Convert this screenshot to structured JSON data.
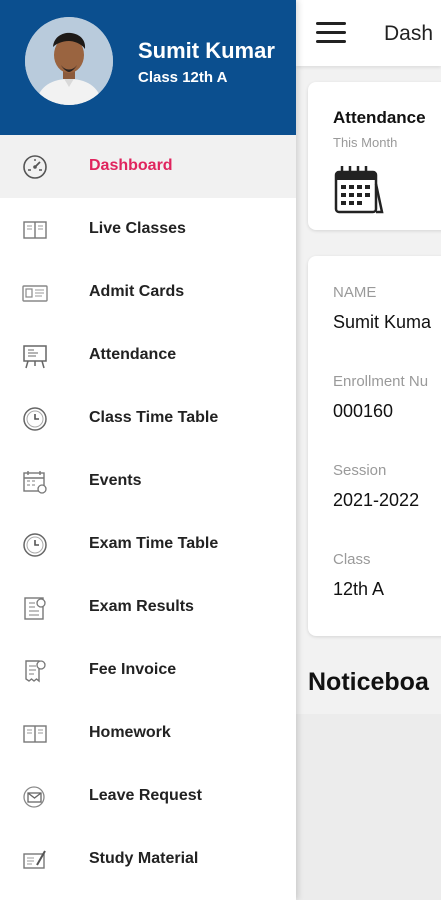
{
  "appbar": {
    "title": "Dash"
  },
  "attendance_card": {
    "title": "Attendance",
    "subtitle": "This Month"
  },
  "student_info": {
    "name_label": "NAME",
    "name_value": "Sumit Kuma",
    "enrollment_label": "Enrollment Nu",
    "enrollment_value": "000160",
    "session_label": "Session",
    "session_value": "2021-2022",
    "class_label": "Class",
    "class_value": "12th A"
  },
  "noticeboard": {
    "title": "Noticeboa"
  },
  "drawer": {
    "user": {
      "name": "Sumit Kumar",
      "class": "Class 12th A"
    },
    "active_color": "#e0245e",
    "header_color": "#0b4f8f",
    "items": [
      {
        "label": "Dashboard",
        "icon": "dashboard-gauge-icon",
        "active": true
      },
      {
        "label": "Live Classes",
        "icon": "book-icon"
      },
      {
        "label": "Admit Cards",
        "icon": "id-card-icon"
      },
      {
        "label": "Attendance",
        "icon": "board-icon"
      },
      {
        "label": "Class Time Table",
        "icon": "clock-icon"
      },
      {
        "label": "Events",
        "icon": "calendar-event-icon"
      },
      {
        "label": "Exam Time Table",
        "icon": "clock-icon"
      },
      {
        "label": "Exam Results",
        "icon": "results-icon"
      },
      {
        "label": "Fee Invoice",
        "icon": "invoice-icon"
      },
      {
        "label": "Homework",
        "icon": "book-icon"
      },
      {
        "label": "Leave Request",
        "icon": "mail-request-icon"
      },
      {
        "label": "Study Material",
        "icon": "study-material-icon"
      }
    ]
  }
}
